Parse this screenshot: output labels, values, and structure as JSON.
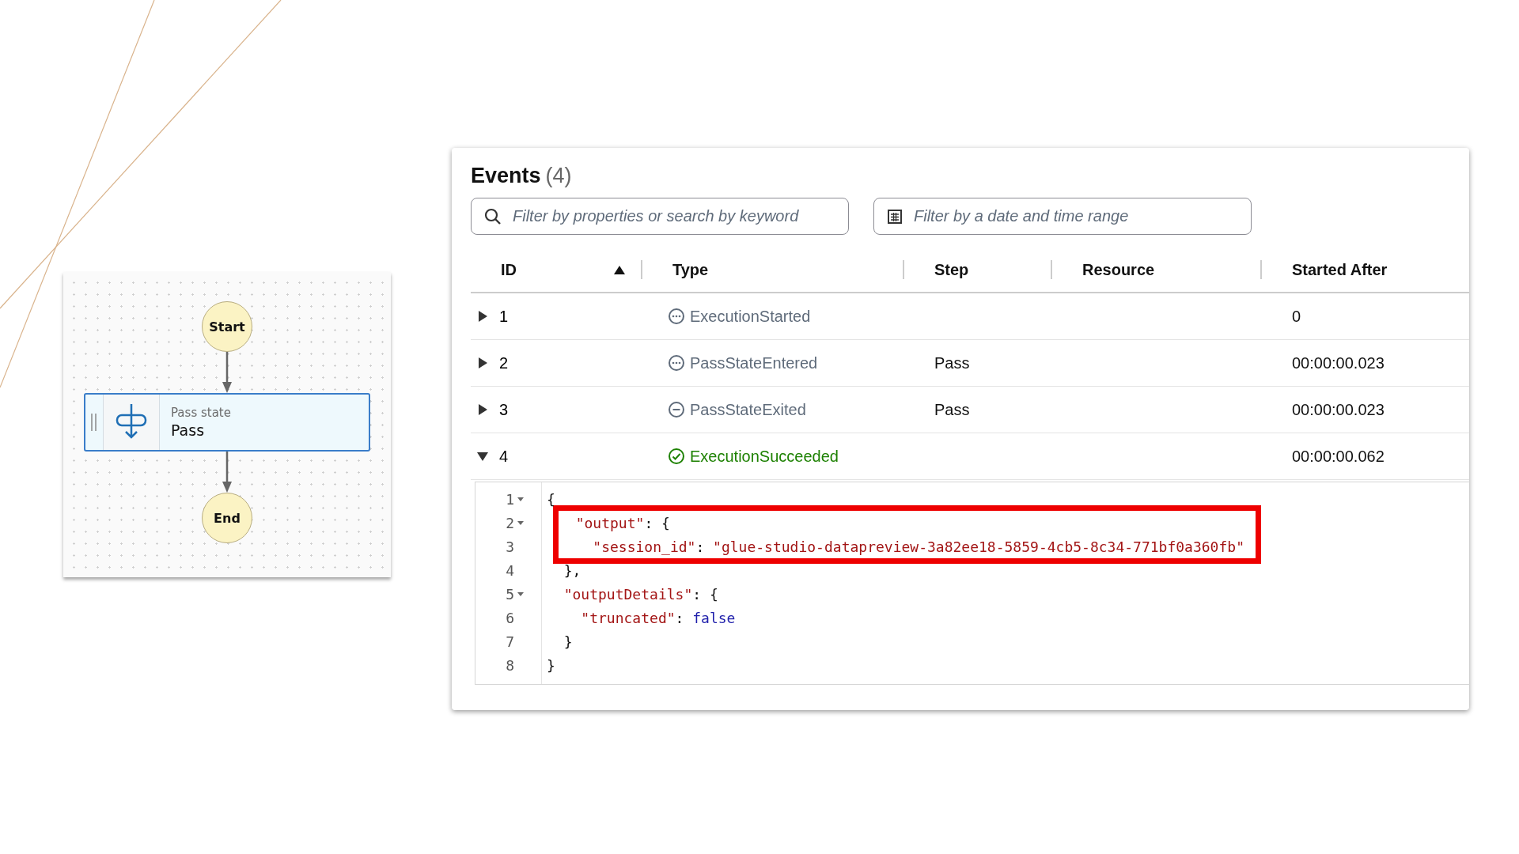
{
  "diagram": {
    "nodes": [
      {
        "kind": "terminal",
        "label": "Start"
      },
      {
        "kind": "state",
        "type_label": "Pass state",
        "label": "Pass",
        "selected": true
      },
      {
        "kind": "terminal",
        "label": "End"
      }
    ]
  },
  "events": {
    "title": "Events",
    "count": "(4)",
    "search": {
      "placeholder": "Filter by properties or search by keyword"
    },
    "date_filter": {
      "placeholder": "Filter by a date and time range"
    },
    "table": {
      "columns": [
        {
          "label": "ID",
          "sorted": true
        },
        {
          "label": "Type",
          "sorted": false
        },
        {
          "label": "Step",
          "sorted": false
        },
        {
          "label": "Resource",
          "sorted": false
        },
        {
          "label": "Started After",
          "sorted": false
        }
      ],
      "rows": [
        {
          "id": "1",
          "expanded": false,
          "kind": "pending",
          "type": "ExecutionStarted",
          "step": "",
          "resource": "",
          "started_after": "0"
        },
        {
          "id": "2",
          "expanded": false,
          "kind": "pending",
          "type": "PassStateEntered",
          "step": "Pass",
          "resource": "",
          "started_after": "00:00:00.023"
        },
        {
          "id": "3",
          "expanded": false,
          "kind": "stopped",
          "type": "PassStateExited",
          "step": "Pass",
          "resource": "",
          "started_after": "00:00:00.023"
        },
        {
          "id": "4",
          "expanded": true,
          "kind": "success",
          "type": "ExecutionSucceeded",
          "step": "",
          "resource": "",
          "started_after": "00:00:00.062"
        }
      ]
    },
    "details": {
      "lines": [
        {
          "number": "1",
          "foldable": true,
          "highlighted": false,
          "parts": [
            {
              "kind": "punct",
              "text": "{"
            }
          ]
        },
        {
          "number": "2",
          "foldable": true,
          "highlighted": true,
          "parts": [
            {
              "kind": "key",
              "text": "  \"output\""
            },
            {
              "kind": "punct",
              "text": ": {"
            }
          ]
        },
        {
          "number": "3",
          "foldable": false,
          "highlighted": true,
          "parts": [
            {
              "kind": "key",
              "text": "    \"session_id\""
            },
            {
              "kind": "punct",
              "text": ": "
            },
            {
              "kind": "string",
              "text": "\"glue-studio-datapreview-3a82ee18-5859-4cb5-8c34-771bf0a360fb\""
            }
          ]
        },
        {
          "number": "4",
          "foldable": false,
          "highlighted": false,
          "parts": [
            {
              "kind": "punct",
              "text": "  },"
            }
          ]
        },
        {
          "number": "5",
          "foldable": true,
          "highlighted": false,
          "parts": [
            {
              "kind": "key",
              "text": "  \"outputDetails\""
            },
            {
              "kind": "punct",
              "text": ": {"
            }
          ]
        },
        {
          "number": "6",
          "foldable": false,
          "highlighted": false,
          "parts": [
            {
              "kind": "key",
              "text": "    \"truncated\""
            },
            {
              "kind": "punct",
              "text": ": "
            },
            {
              "kind": "literal",
              "text": "false"
            }
          ]
        },
        {
          "number": "7",
          "foldable": false,
          "highlighted": false,
          "parts": [
            {
              "kind": "punct",
              "text": "  }"
            }
          ]
        },
        {
          "number": "8",
          "foldable": false,
          "highlighted": false,
          "parts": [
            {
              "kind": "punct",
              "text": "}"
            }
          ]
        }
      ]
    }
  }
}
